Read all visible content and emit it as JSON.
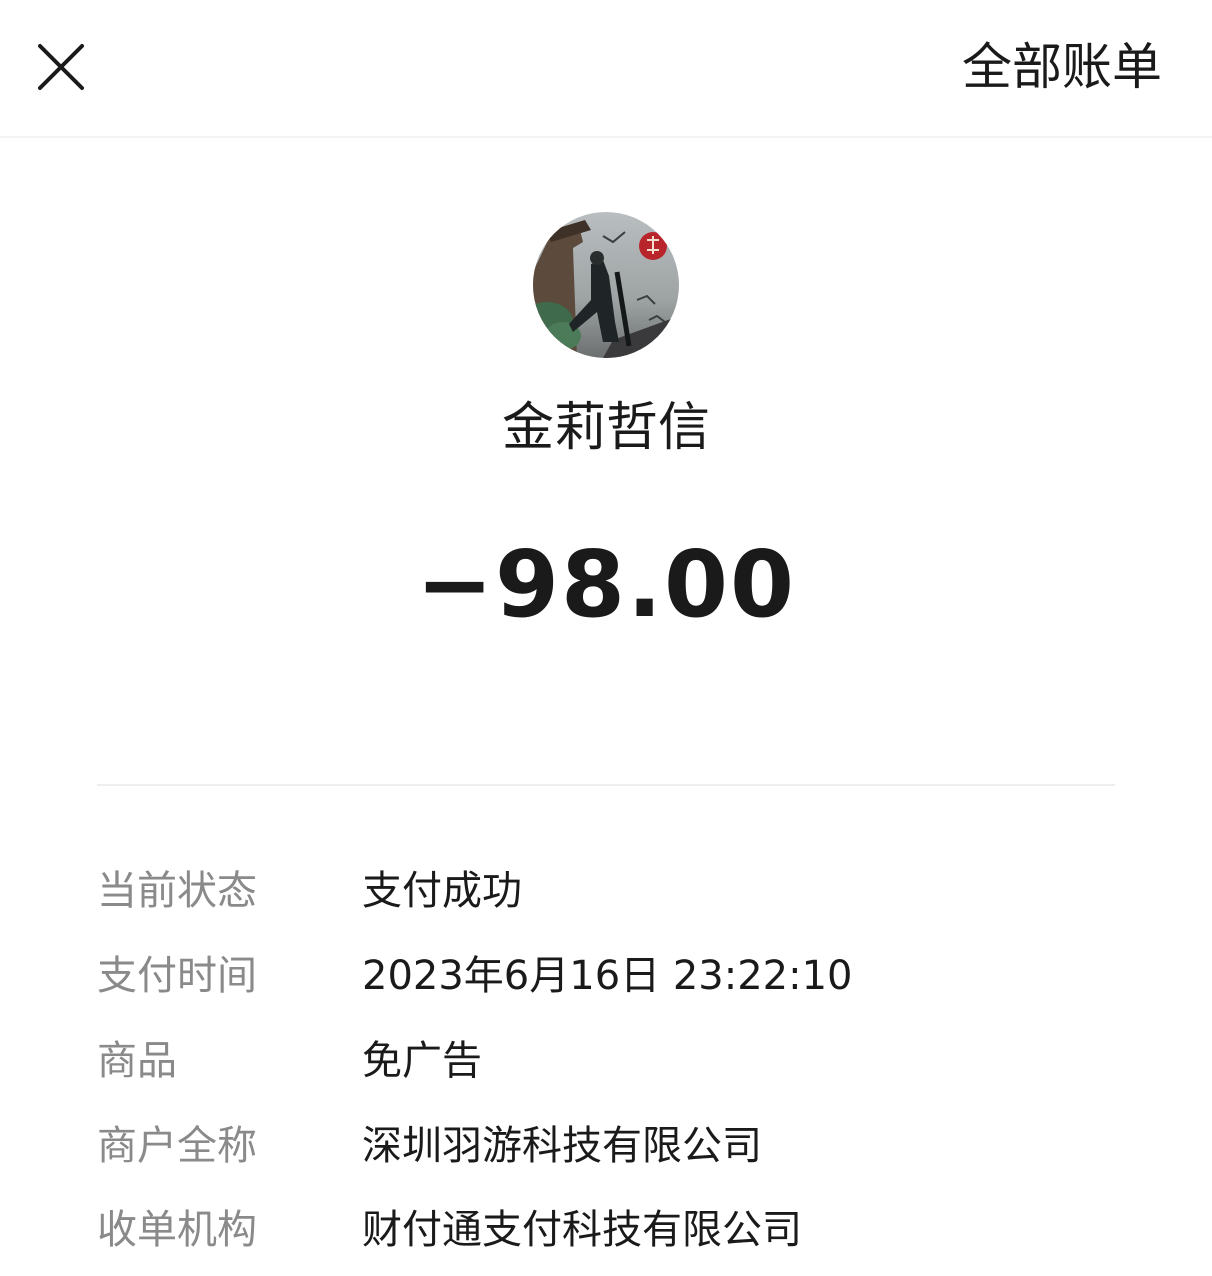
{
  "header": {
    "close_icon": "close-icon",
    "all_bills_label": "全部账单"
  },
  "merchant": {
    "avatar": "merchant-avatar-image",
    "name": "金莉哲信"
  },
  "amount": "−98.00",
  "details": [
    {
      "label": "当前状态",
      "value": "支付成功"
    },
    {
      "label": "支付时间",
      "value": "2023年6月16日 23:22:10"
    },
    {
      "label": "商品",
      "value": "免广告"
    },
    {
      "label": "商户全称",
      "value": "深圳羽游科技有限公司"
    },
    {
      "label": "收单机构",
      "value": "财付通支付科技有限公司"
    }
  ]
}
